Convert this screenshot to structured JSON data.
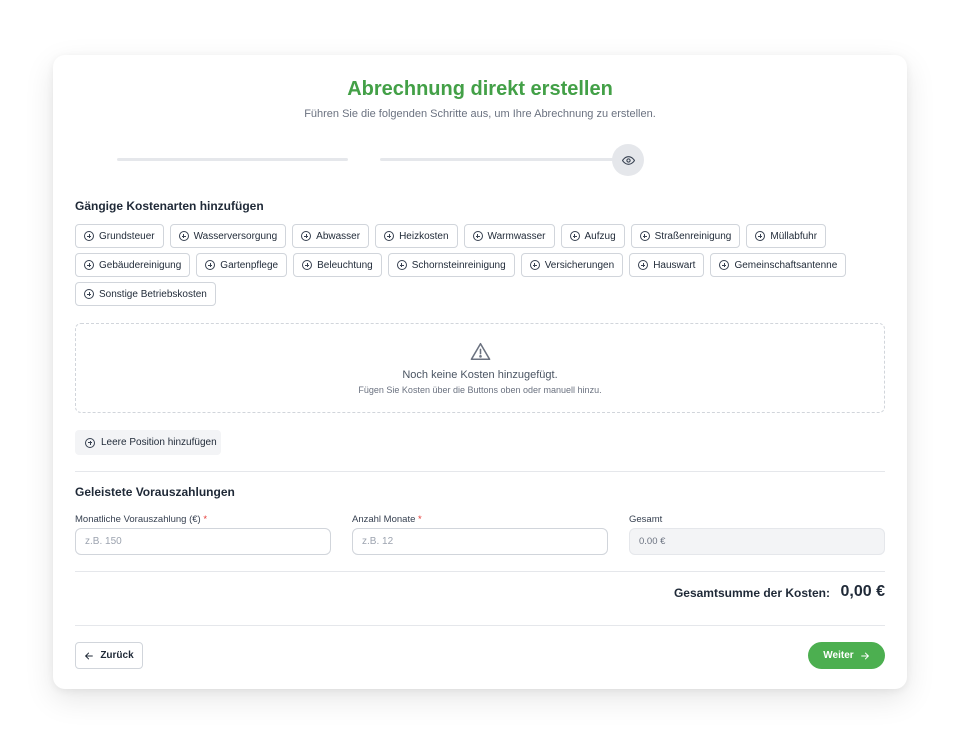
{
  "header": {
    "title": "Abrechnung direkt erstellen",
    "subtitle": "Führen Sie die folgenden Schritte aus, um Ihre Abrechnung zu erstellen."
  },
  "steps": {
    "current_icon": "eye-icon"
  },
  "cost_types": {
    "title": "Gängige Kostenarten hinzufügen",
    "items": [
      "Grundsteuer",
      "Wasserversorgung",
      "Abwasser",
      "Heizkosten",
      "Warmwasser",
      "Aufzug",
      "Straßenreinigung",
      "Müllabfuhr",
      "Gebäudereinigung",
      "Gartenpflege",
      "Beleuchtung",
      "Schornsteinreinigung",
      "Versicherungen",
      "Hauswart",
      "Gemeinschaftsantenne",
      "Sonstige Betriebskosten"
    ]
  },
  "empty_state": {
    "icon": "warning-icon",
    "message": "Noch keine Kosten hinzugefügt.",
    "hint": "Fügen Sie Kosten über die Buttons oben oder manuell hinzu."
  },
  "add_empty_label": "Leere Position hinzufügen",
  "advance_payments": {
    "title": "Geleistete Vorauszahlungen",
    "monthly_label": "Monatliche Vorauszahlung (€)",
    "monthly_placeholder": "z.B. 150",
    "months_label": "Anzahl Monate",
    "months_placeholder": "z.B. 12",
    "required_marker": "*",
    "total_label": "Gesamt",
    "total_value": "0.00 €"
  },
  "summary": {
    "label": "Gesamtsumme der Kosten:",
    "value": "0,00 €"
  },
  "nav": {
    "back_label": "Zurück",
    "next_label": "Weiter"
  },
  "colors": {
    "accent": "#43a047",
    "button": "#4caf50",
    "required": "#e53935"
  }
}
